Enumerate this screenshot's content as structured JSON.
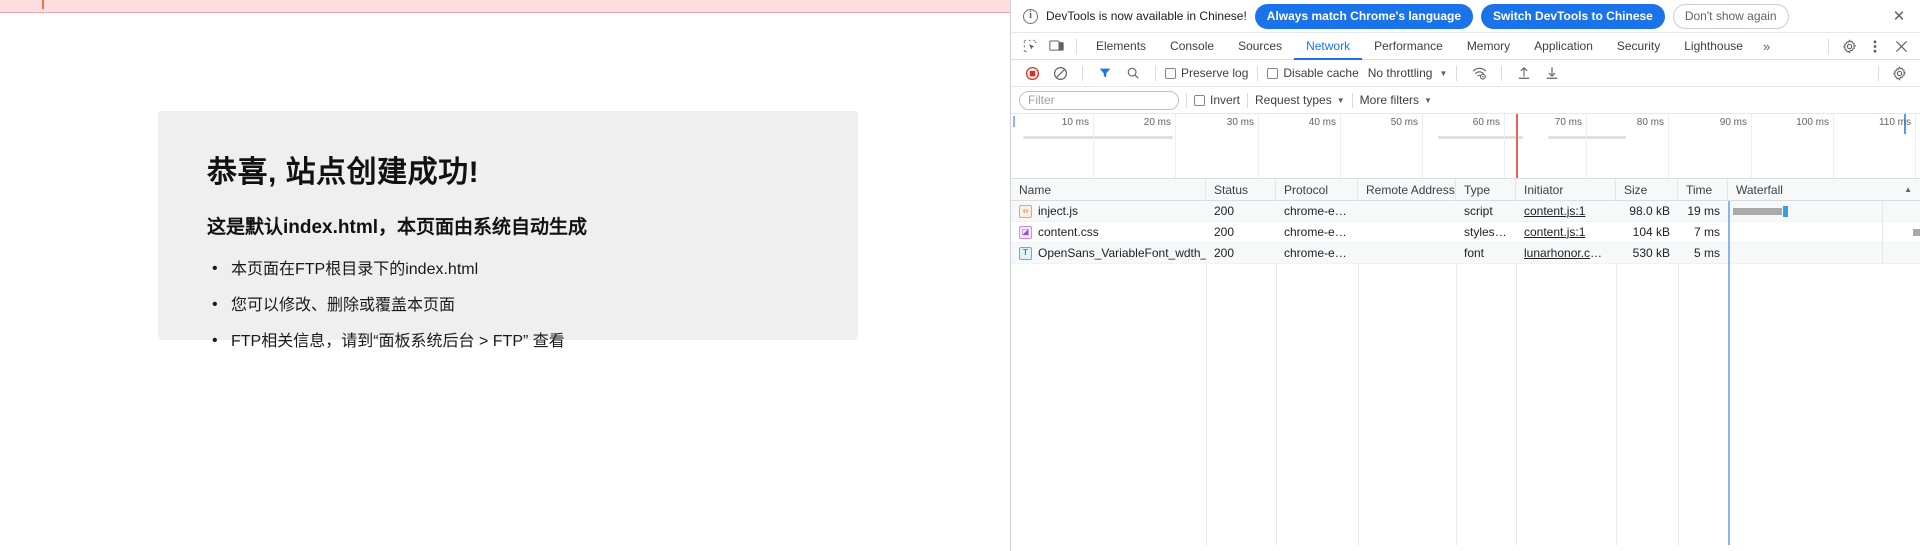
{
  "page": {
    "heading": "恭喜, 站点创建成功!",
    "subheading": "这是默认index.html，本页面由系统自动生成",
    "bullets": [
      "本页面在FTP根目录下的index.html",
      "您可以修改、删除或覆盖本页面",
      "FTP相关信息，请到“面板系统后台 > FTP” 查看"
    ]
  },
  "devtools": {
    "banner": {
      "icon": "info-icon",
      "message": "DevTools is now available in Chinese!",
      "primary_button": "Always match Chrome's language",
      "secondary_button": "Switch DevTools to Chinese",
      "dismiss_button": "Don't show again",
      "close_icon": "✕"
    },
    "tabs": [
      {
        "label": "Elements",
        "active": false
      },
      {
        "label": "Console",
        "active": false
      },
      {
        "label": "Sources",
        "active": false
      },
      {
        "label": "Network",
        "active": true
      },
      {
        "label": "Performance",
        "active": false
      },
      {
        "label": "Memory",
        "active": false
      },
      {
        "label": "Application",
        "active": false
      },
      {
        "label": "Security",
        "active": false
      },
      {
        "label": "Lighthouse",
        "active": false
      }
    ],
    "tabs_overflow": "»",
    "toolbar": {
      "record_title": "record-button",
      "clear_title": "clear-button",
      "filter_title": "filter-toggle",
      "search_title": "search-button",
      "preserve_log": "Preserve log",
      "disable_cache": "Disable cache",
      "throttling": "No throttling",
      "caret": "▼"
    },
    "filterbar": {
      "filter_placeholder": "Filter",
      "filter_value": "",
      "invert": "Invert",
      "request_types": "Request types",
      "more_filters": "More filters",
      "caret": "▼"
    },
    "timeline": {
      "ticks": [
        "10 ms",
        "20 ms",
        "30 ms",
        "40 ms",
        "50 ms",
        "60 ms",
        "70 ms",
        "80 ms",
        "90 ms",
        "100 ms",
        "110 ms"
      ]
    },
    "table": {
      "columns": [
        "Name",
        "Status",
        "Protocol",
        "Remote Address",
        "Type",
        "Initiator",
        "Size",
        "Time",
        "Waterfall"
      ],
      "sort_caret": "▲",
      "rows": [
        {
          "icon": "script-file-icon",
          "icon_glyph": "‹›",
          "icon_class": "script",
          "name": "inject.js",
          "status": "200",
          "protocol": "chrome-ext…",
          "remote_address": "",
          "type": "script",
          "initiator": "content.js:1",
          "size": "98.0 kB",
          "time": "19 ms",
          "wait_left_pct": 1.5,
          "wait_width_pct": 16,
          "dl_left_pct": 17.5,
          "dl_width_pct": 1.6
        },
        {
          "icon": "stylesheet-file-icon",
          "icon_glyph": "◪",
          "icon_class": "stylesheet",
          "name": "content.css",
          "status": "200",
          "protocol": "chrome-ext…",
          "remote_address": "",
          "type": "styleshe…",
          "initiator": "content.js:1",
          "size": "104 kB",
          "time": "7 ms",
          "wait_left_pct": 49.5,
          "wait_width_pct": 2.4,
          "dl_left_pct": 52,
          "dl_width_pct": 3.6
        },
        {
          "icon": "font-file-icon",
          "icon_glyph": "T",
          "icon_class": "font",
          "name": "OpenSans_VariableFont_wdth_…",
          "status": "200",
          "protocol": "chrome-ext…",
          "remote_address": "",
          "type": "font",
          "initiator": "lunarhonor.com/",
          "size": "530 kB",
          "time": "5 ms",
          "wait_left_pct": 58.5,
          "wait_width_pct": 2.2,
          "dl_left_pct": 61,
          "dl_width_pct": 1.2
        }
      ]
    }
  },
  "colors": {
    "accent": "#1a73e8",
    "topbar": "#ffdde1",
    "card_bg": "#efefef",
    "waterfall_wait": "#aaaaaa",
    "waterfall_download": "#34a0e8",
    "load_event_red": "#e8908a",
    "dom_event_blue": "#8ab4f8"
  }
}
